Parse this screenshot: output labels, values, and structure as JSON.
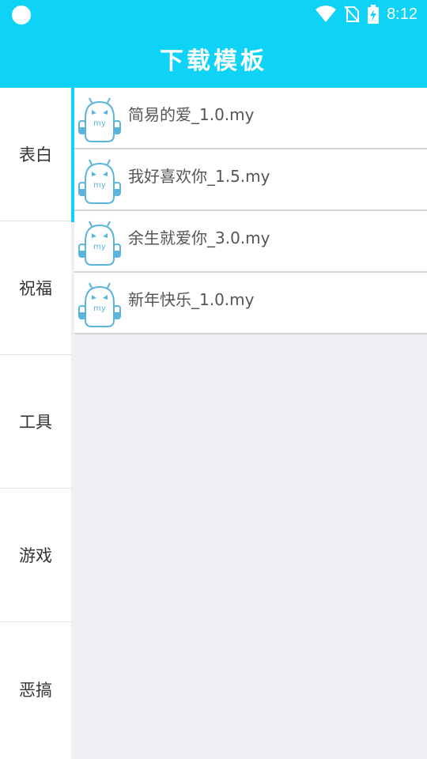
{
  "status": {
    "time": "8:12"
  },
  "header": {
    "title": "下载模板"
  },
  "sidebar": {
    "categories": [
      {
        "label": "表白"
      },
      {
        "label": "祝福"
      },
      {
        "label": "工具"
      },
      {
        "label": "游戏"
      },
      {
        "label": "恶搞"
      }
    ]
  },
  "templates": [
    {
      "name": "简易的爱_1.0.my",
      "icon": "my-robot-icon"
    },
    {
      "name": "我好喜欢你_1.5.my",
      "icon": "my-robot-icon"
    },
    {
      "name": "余生就爱你_3.0.my",
      "icon": "my-robot-icon"
    },
    {
      "name": "新年快乐_1.0.my",
      "icon": "my-robot-icon"
    }
  ],
  "colors": {
    "accent": "#0fd2f7",
    "background": "#efeff4"
  }
}
